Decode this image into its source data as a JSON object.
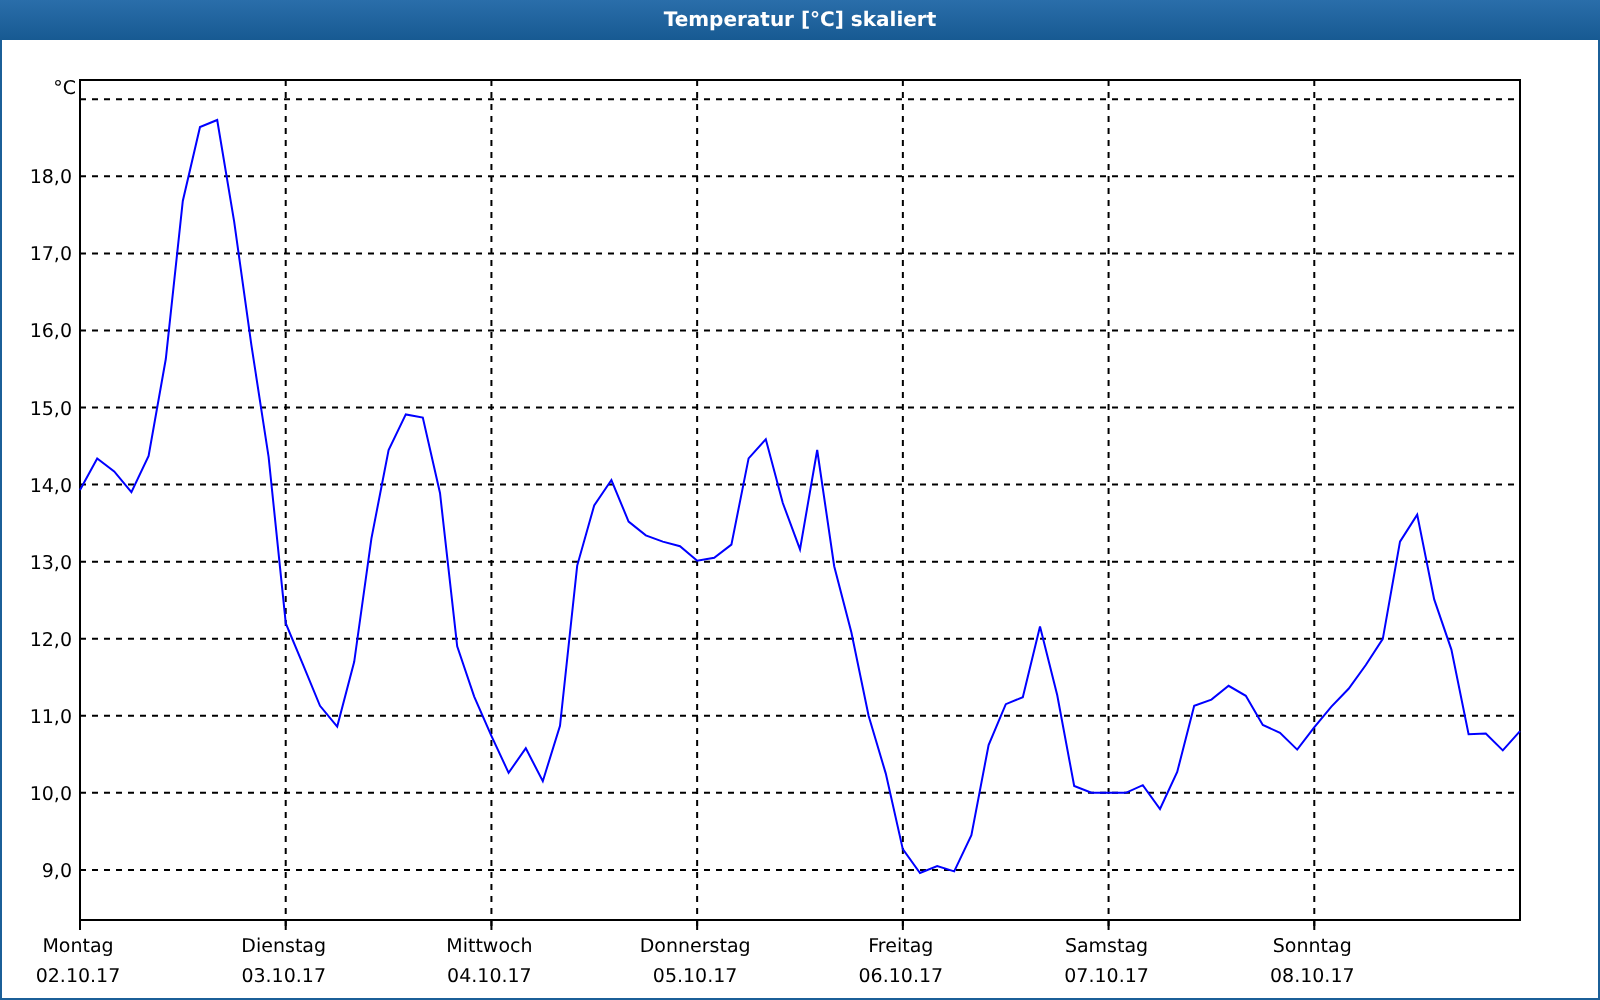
{
  "window": {
    "title": "Temperatur [°C] skaliert"
  },
  "chart": {
    "chart_data": {
      "type": "line",
      "ylabel": "°C",
      "ylim": [
        8.35,
        19.25
      ],
      "grid": true,
      "yticks": [
        {
          "value": 9,
          "label": "9,0"
        },
        {
          "value": 10,
          "label": "10,0"
        },
        {
          "value": 11,
          "label": "11,0"
        },
        {
          "value": 12,
          "label": "12,0"
        },
        {
          "value": 13,
          "label": "13,0"
        },
        {
          "value": 14,
          "label": "14,0"
        },
        {
          "value": 15,
          "label": "15,0"
        },
        {
          "value": 16,
          "label": "16,0"
        },
        {
          "value": 17,
          "label": "17,0"
        },
        {
          "value": 18,
          "label": "18,0"
        }
      ],
      "categories": [
        "Montag",
        null,
        null,
        null,
        null,
        null,
        null,
        null,
        null,
        null,
        null,
        null,
        "Dienstag",
        null,
        null,
        null,
        null,
        null,
        null,
        null,
        null,
        null,
        null,
        null,
        "Mittwoch",
        null,
        null,
        null,
        null,
        null,
        null,
        null,
        null,
        null,
        null,
        null,
        "Donnerstag",
        null,
        null,
        null,
        null,
        null,
        null,
        null,
        null,
        null,
        null,
        null,
        "Freitag",
        null,
        null,
        null,
        null,
        null,
        null,
        null,
        null,
        null,
        null,
        null,
        "Samstag",
        null,
        null,
        null,
        null,
        null,
        null,
        null,
        null,
        null,
        null,
        null,
        "Sonntag",
        null,
        null,
        null,
        null,
        null,
        null,
        null,
        null,
        null,
        null,
        null,
        null
      ],
      "series": [
        {
          "color": "#0000ff",
          "values": [
            13.93,
            14.34,
            14.17,
            13.9,
            14.37,
            15.63,
            17.68,
            18.64,
            18.73,
            17.41,
            15.81,
            14.36,
            12.2,
            11.67,
            11.13,
            10.86,
            11.7,
            13.3,
            14.45,
            14.91,
            14.87,
            13.89,
            11.9,
            11.25,
            10.74,
            10.26,
            10.58,
            10.15,
            10.87,
            12.95,
            13.73,
            14.06,
            13.52,
            13.34,
            13.26,
            13.2,
            13.01,
            13.05,
            13.22,
            14.34,
            14.59,
            13.76,
            13.16,
            14.45,
            12.94,
            12.08,
            11.0,
            10.25,
            9.27,
            8.96,
            9.05,
            8.98,
            9.45,
            10.62,
            11.15,
            11.24,
            12.16,
            11.27,
            10.09,
            10.0,
            10.0,
            10.0,
            10.1,
            9.79,
            10.27,
            11.13,
            11.21,
            11.39,
            11.26,
            10.88,
            10.78,
            10.56,
            10.85,
            11.12,
            11.35,
            11.66,
            12.0,
            13.26,
            13.61,
            12.51,
            11.86,
            10.76,
            10.77,
            10.55,
            10.8
          ]
        }
      ]
    },
    "x_dates": [
      "02.10.17",
      "03.10.17",
      "04.10.17",
      "05.10.17",
      "06.10.17",
      "07.10.17",
      "08.10.17"
    ]
  }
}
